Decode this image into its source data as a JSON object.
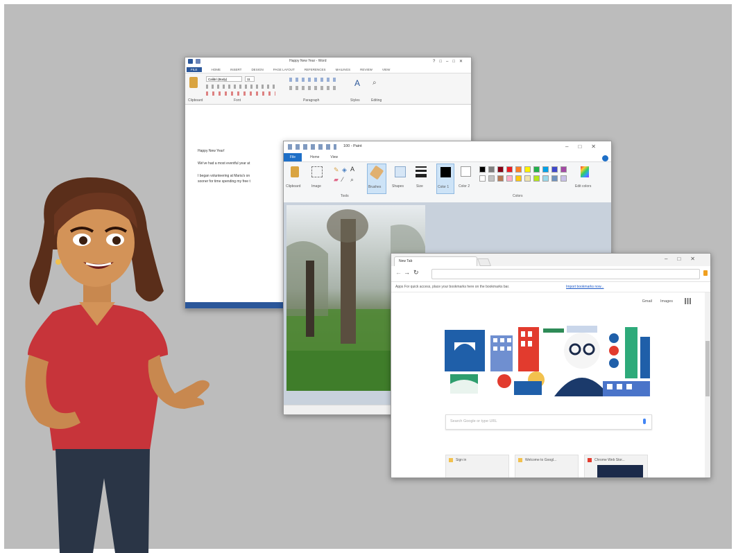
{
  "word": {
    "title": "Happy New Year - Word",
    "ribbon_tabs": [
      "FILE",
      "HOME",
      "INSERT",
      "DESIGN",
      "PAGE LAYOUT",
      "REFERENCES",
      "MAILINGS",
      "REVIEW",
      "VIEW"
    ],
    "font_name": "Calibri (Body)",
    "font_size": "11",
    "doc_lines": [
      "Happy New Year!",
      "We've had a most eventful year at",
      "I began volunteering at Maria's on",
      "sooner for time spending my free t"
    ],
    "ribbon_group_labels": [
      "Clipboard",
      "Font",
      "Paragraph",
      "Styles",
      "Editing"
    ]
  },
  "paint": {
    "title": "100 - Paint",
    "ribbon_tabs": [
      "File",
      "Home",
      "View"
    ],
    "group_labels": [
      "Clipboard",
      "Image",
      "Tools",
      "Brushes",
      "Shapes",
      "Size",
      "Color 1",
      "Color 2",
      "Edit colors"
    ],
    "colors_group_label": "Colors",
    "palette": [
      "#000000",
      "#7f7f7f",
      "#880015",
      "#ed1c24",
      "#ff7f27",
      "#fff200",
      "#22b14c",
      "#00a2e8",
      "#3f48cc",
      "#a349a4",
      "#ffffff",
      "#c3c3c3",
      "#b97a57",
      "#ffaec9",
      "#ffc90e",
      "#efe4b0",
      "#b5e61d",
      "#99d9ea",
      "#7092be",
      "#c8bfe7"
    ]
  },
  "chrome": {
    "tab_title": "New Tab",
    "bookmarks_text": "Apps   For quick access, place your bookmarks here on the bookmarks bar.",
    "bookmarks_link": "Import bookmarks now...",
    "header_links": [
      "Gmail",
      "Images"
    ],
    "search_placeholder": "Search Google or type URL",
    "tiles": [
      "Sign in",
      "Welcome to Googl...",
      "Chrome Web Stor..."
    ]
  },
  "colors": {
    "background": "#bcbcbc",
    "word_blue": "#2b579a",
    "paint_blue": "#1e6fc7"
  }
}
